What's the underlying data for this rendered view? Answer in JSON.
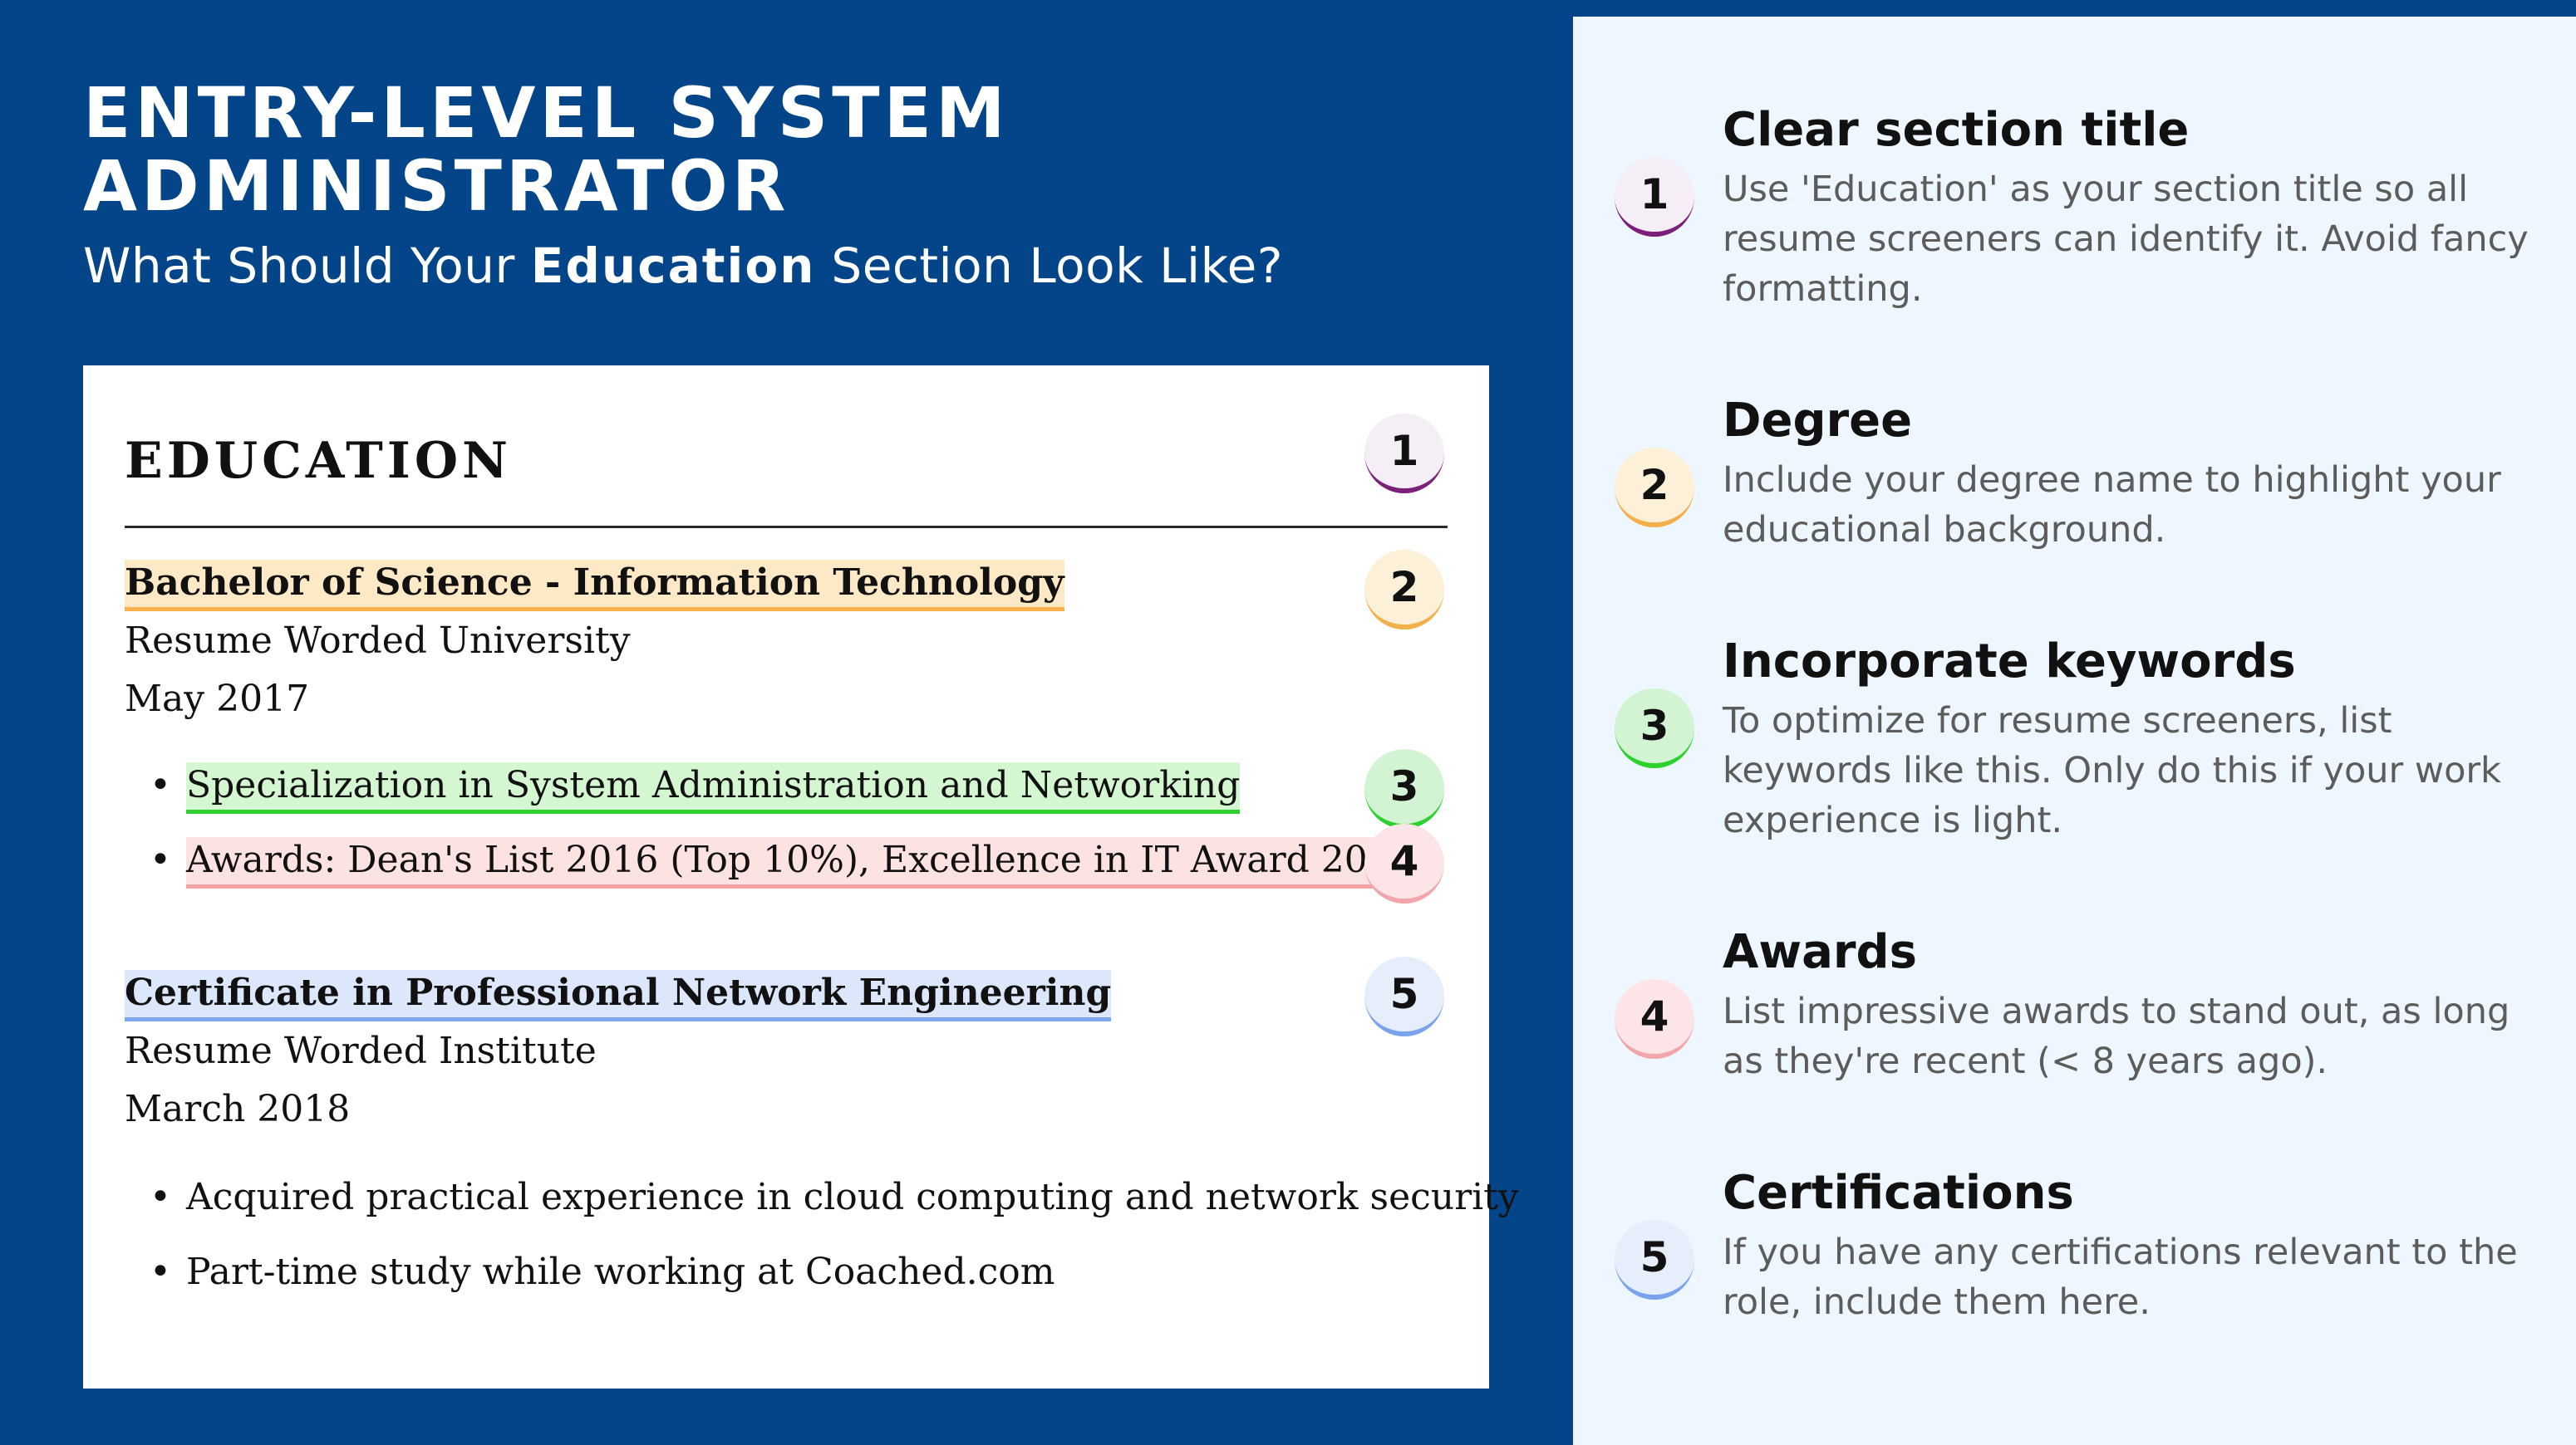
{
  "header": {
    "title_line1": "ENTRY-LEVEL SYSTEM",
    "title_line2": "ADMINISTRATOR",
    "subtitle_pre": "What Should Your ",
    "subtitle_bold": "Education",
    "subtitle_post": " Section Look Like?"
  },
  "resume": {
    "heading": "EDUCATION",
    "entry1": {
      "degree": "Bachelor of Science - Information Technology",
      "school": "Resume Worded University",
      "date": "May 2017",
      "bullets": [
        "Specialization in System Administration and Networking",
        "Awards: Dean's List 2016 (Top 10%), Excellence in IT Award 2017"
      ]
    },
    "entry2": {
      "degree": "Certificate in Professional Network Engineering",
      "school": "Resume Worded Institute",
      "date": "March 2018",
      "bullets": [
        "Acquired practical experience in cloud computing and network security",
        "Part-time study while working at Coached.com"
      ]
    },
    "bullet_char": "•"
  },
  "markers": [
    "1",
    "2",
    "3",
    "4",
    "5"
  ],
  "tips": [
    {
      "number": "1",
      "title": "Clear section title",
      "text": "Use 'Education' as your section title so all resume screeners can identify it. Avoid fancy formatting."
    },
    {
      "number": "2",
      "title": "Degree",
      "text": "Include your degree name to highlight your educational background."
    },
    {
      "number": "3",
      "title": "Incorporate keywords",
      "text": "To optimize for resume screeners, list keywords like this. Only do this if your work experience is light."
    },
    {
      "number": "4",
      "title": "Awards",
      "text": "List impressive awards to stand out, as long as they're recent (< 8 years ago)."
    },
    {
      "number": "5",
      "title": "Certifications",
      "text": "If you have any certifications relevant to the role, include them here."
    }
  ],
  "colors": {
    "background": "#04458a",
    "panel": "#eef6ff",
    "marker1": "#7a1f7a",
    "marker2": "#f3b04a",
    "marker3": "#2dd12d",
    "marker4": "#f2a6ab",
    "marker5": "#7aa3ec"
  }
}
